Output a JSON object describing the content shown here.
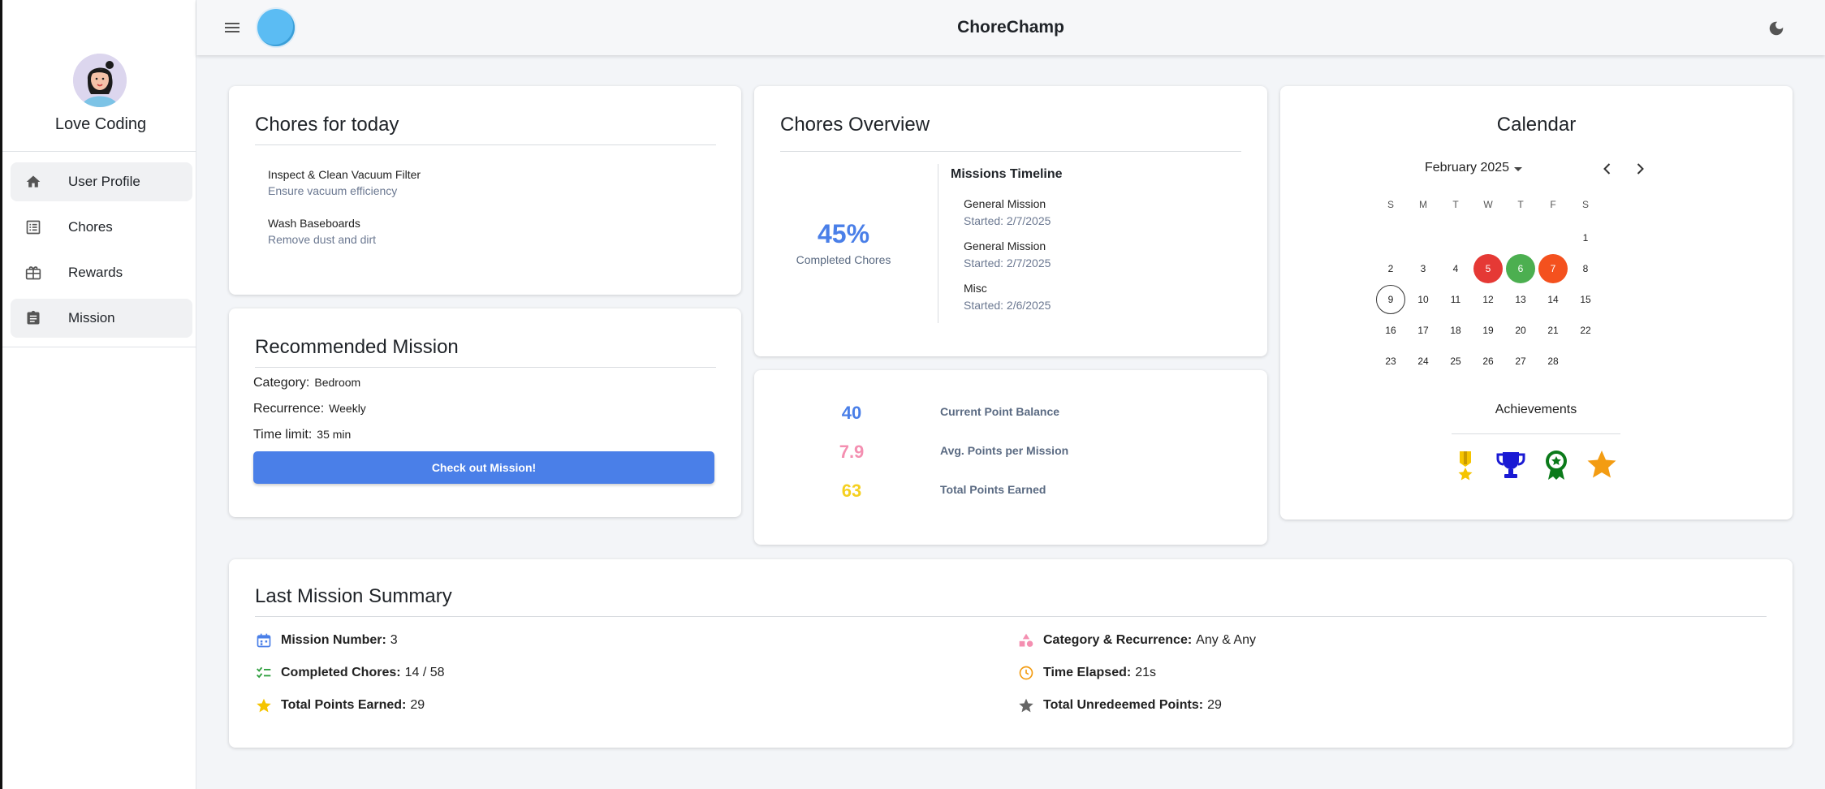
{
  "user": {
    "name": "Love Coding"
  },
  "nav": [
    {
      "label": "User Profile",
      "icon": "home-icon",
      "active": true
    },
    {
      "label": "Chores",
      "icon": "list-icon",
      "active": false
    },
    {
      "label": "Rewards",
      "icon": "gift-icon",
      "active": false
    },
    {
      "label": "Mission",
      "icon": "clipboard-icon",
      "active": true
    }
  ],
  "header": {
    "title": "ChoreChamp"
  },
  "chores_today": {
    "title": "Chores for today",
    "items": [
      {
        "name": "Inspect & Clean Vacuum Filter",
        "desc": "Ensure vacuum efficiency"
      },
      {
        "name": "Wash Baseboards",
        "desc": "Remove dust and dirt"
      }
    ]
  },
  "recommended": {
    "title": "Recommended Mission",
    "category_label": "Category:",
    "category": "Bedroom",
    "recurrence_label": "Recurrence:",
    "recurrence": "Weekly",
    "time_label": "Time limit:",
    "time": "35 min",
    "button": "Check out Mission!"
  },
  "overview": {
    "title": "Chores Overview",
    "percent": "45%",
    "percent_label": "Completed Chores",
    "timeline_title": "Missions Timeline",
    "timeline": [
      {
        "name": "General Mission",
        "started": "Started: 2/7/2025"
      },
      {
        "name": "General Mission",
        "started": "Started: 2/7/2025"
      },
      {
        "name": "Misc",
        "started": "Started: 2/6/2025"
      }
    ]
  },
  "points": [
    {
      "value": "40",
      "label": "Current Point Balance",
      "color": "#4a7fe8"
    },
    {
      "value": "7.9",
      "label": "Avg. Points per Mission",
      "color": "#f48fb1"
    },
    {
      "value": "63",
      "label": "Total Points Earned",
      "color": "#f5d020"
    }
  ],
  "calendar": {
    "title": "Calendar",
    "month": "February 2025",
    "weekdays": [
      "S",
      "M",
      "T",
      "W",
      "T",
      "F",
      "S"
    ],
    "weeks": [
      [
        "",
        "",
        "",
        "",
        "",
        "",
        "1"
      ],
      [
        "2",
        "3",
        "4",
        "5",
        "6",
        "7",
        "8"
      ],
      [
        "9",
        "10",
        "11",
        "12",
        "13",
        "14",
        "15"
      ],
      [
        "16",
        "17",
        "18",
        "19",
        "20",
        "21",
        "22"
      ],
      [
        "23",
        "24",
        "25",
        "26",
        "27",
        "28",
        ""
      ]
    ],
    "highlight": {
      "5": "red",
      "6": "green",
      "7": "orange",
      "9": "today"
    },
    "achievements_title": "Achievements",
    "achievements": [
      "medal-icon",
      "trophy-icon",
      "badge-icon",
      "star-icon"
    ]
  },
  "summary": {
    "title": "Last Mission Summary",
    "mission_number_label": "Mission Number:",
    "mission_number": "3",
    "completed_label": "Completed Chores:",
    "completed": "14 / 58",
    "points_label": "Total Points Earned:",
    "points": "29",
    "category_label": "Category & Recurrence:",
    "category": "Any & Any",
    "elapsed_label": "Time Elapsed:",
    "elapsed": "21s",
    "unredeemed_label": "Total Unredeemed Points:",
    "unredeemed": "29"
  }
}
